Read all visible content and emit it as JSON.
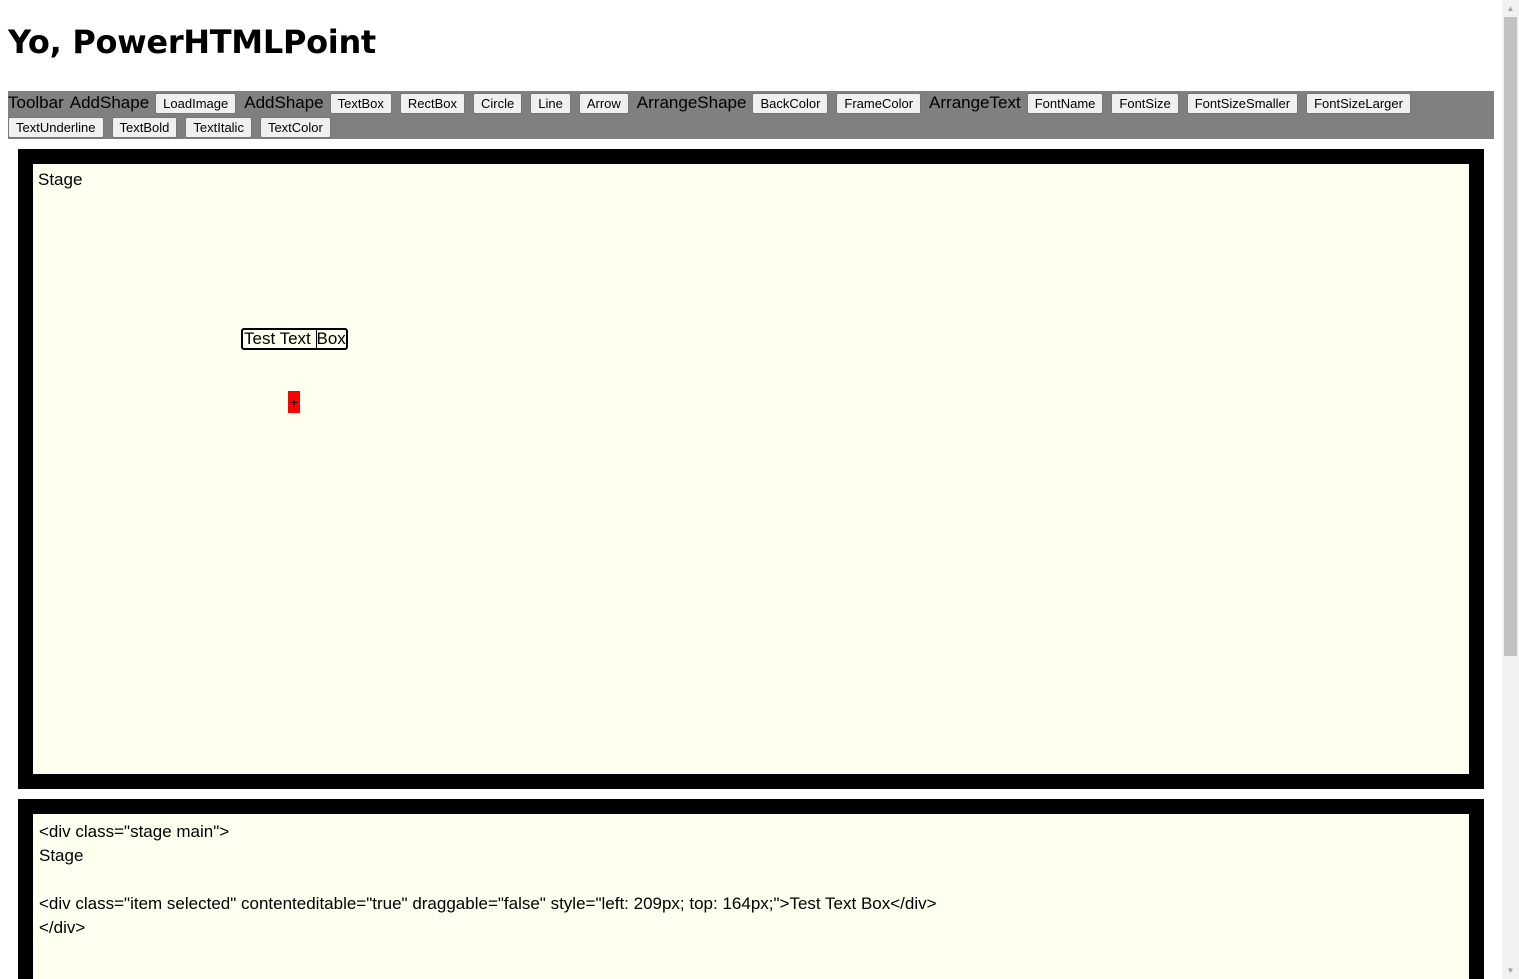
{
  "page_title": "Yo, PowerHTMLPoint",
  "toolbar": {
    "label_toolbar": "Toolbar",
    "label_addshape_1": "AddShape",
    "btn_loadimage": "LoadImage",
    "label_addshape_2": "AddShape",
    "btn_textbox": "TextBox",
    "btn_rectbox": "RectBox",
    "btn_circle": "Circle",
    "btn_line": "Line",
    "btn_arrow": "Arrow",
    "label_arrangeshape": "ArrangeShape",
    "btn_backcolor": "BackColor",
    "btn_framecolor": "FrameColor",
    "label_arrangetext": "ArrangeText",
    "btn_fontname": "FontName",
    "btn_fontsize": "FontSize",
    "btn_fontsizesmaller": "FontSizeSmaller",
    "btn_fontsizelarger": "FontSizeLarger",
    "btn_textunderline": "TextUnderline",
    "btn_textbold": "TextBold",
    "btn_textitalic": "TextItalic",
    "btn_textcolor": "TextColor"
  },
  "stage": {
    "label": "Stage",
    "textbox_part1": "Test Text ",
    "textbox_part2": "Box",
    "handle_glyph": "+"
  },
  "source": {
    "line1": "<div class=\"stage main\">",
    "line2": "Stage",
    "line3": "",
    "line4": "<div class=\"item selected\" contenteditable=\"true\" draggable=\"false\" style=\"left: 209px; top: 164px;\">Test Text Box</div>",
    "line5": "</div>"
  },
  "colors": {
    "toolbar_bg": "#808080",
    "stage_bg": "#fffff0",
    "stage_border": "#000000",
    "handle": "#ff0000"
  },
  "icons": {
    "scroll_up": "scroll-up-arrow-icon",
    "scroll_down": "scroll-down-arrow-icon"
  }
}
